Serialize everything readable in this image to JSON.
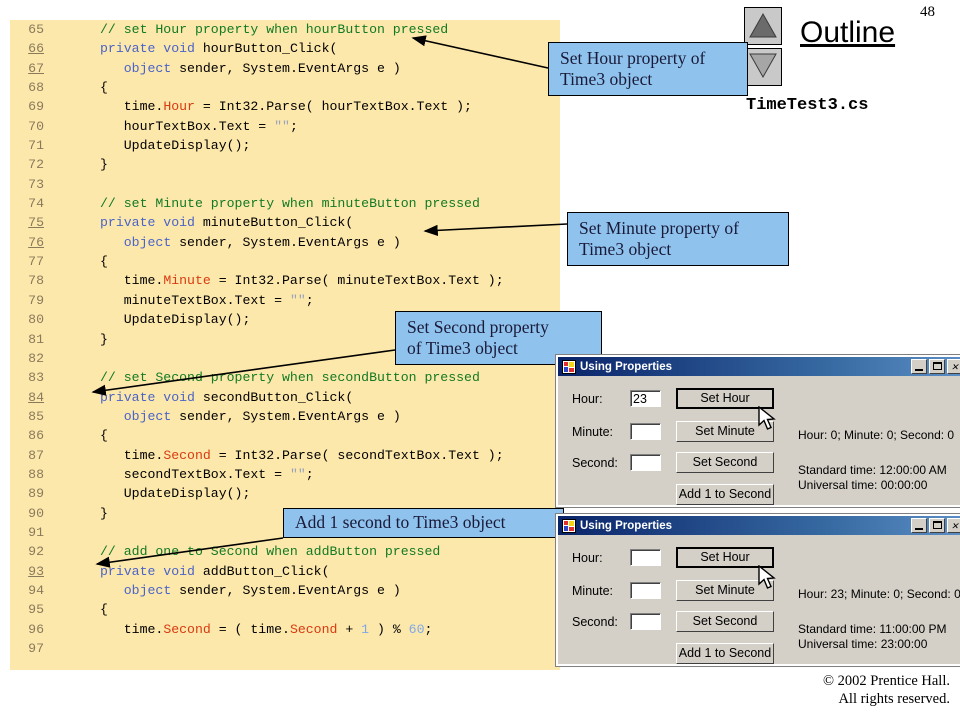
{
  "page": {
    "number": "48",
    "outline_title": "Outline",
    "file_label": "TimeTest3.cs"
  },
  "nav": {
    "up_icon": "triangle-up-icon",
    "down_icon": "triangle-down-icon"
  },
  "code": {
    "lines": [
      {
        "no": "65",
        "underline": false,
        "segments": [
          {
            "t": "// set Hour property when hourButton pressed",
            "c": "cm"
          }
        ]
      },
      {
        "no": "66",
        "underline": true,
        "segments": [
          {
            "t": "private void ",
            "c": "kw"
          },
          {
            "t": "hourButton_Click(",
            "c": ""
          }
        ]
      },
      {
        "no": "67",
        "underline": true,
        "segments": [
          {
            "t": "   ",
            "c": ""
          },
          {
            "t": "object",
            "c": "kw"
          },
          {
            "t": " sender, System.EventArgs e )",
            "c": ""
          }
        ]
      },
      {
        "no": "68",
        "underline": false,
        "segments": [
          {
            "t": "{",
            "c": ""
          }
        ]
      },
      {
        "no": "69",
        "underline": false,
        "segments": [
          {
            "t": "   time.",
            "c": ""
          },
          {
            "t": "Hour",
            "c": "pr"
          },
          {
            "t": " = Int32.Parse( hourTextBox.Text );",
            "c": ""
          }
        ]
      },
      {
        "no": "70",
        "underline": false,
        "segments": [
          {
            "t": "   hourTextBox.Text = ",
            "c": ""
          },
          {
            "t": "\"\"",
            "c": "st"
          },
          {
            "t": ";",
            "c": ""
          }
        ]
      },
      {
        "no": "71",
        "underline": false,
        "segments": [
          {
            "t": "   UpdateDisplay();",
            "c": ""
          }
        ]
      },
      {
        "no": "72",
        "underline": false,
        "segments": [
          {
            "t": "}",
            "c": ""
          }
        ]
      },
      {
        "no": "73",
        "underline": false,
        "segments": [
          {
            "t": "",
            "c": ""
          }
        ]
      },
      {
        "no": "74",
        "underline": false,
        "segments": [
          {
            "t": "// set Minute property when minuteButton pressed",
            "c": "cm"
          }
        ]
      },
      {
        "no": "75",
        "underline": true,
        "segments": [
          {
            "t": "private void ",
            "c": "kw"
          },
          {
            "t": "minuteButton_Click(",
            "c": ""
          }
        ]
      },
      {
        "no": "76",
        "underline": true,
        "segments": [
          {
            "t": "   ",
            "c": ""
          },
          {
            "t": "object",
            "c": "kw"
          },
          {
            "t": " sender, System.EventArgs e )",
            "c": ""
          }
        ]
      },
      {
        "no": "77",
        "underline": false,
        "segments": [
          {
            "t": "{",
            "c": ""
          }
        ]
      },
      {
        "no": "78",
        "underline": false,
        "segments": [
          {
            "t": "   time.",
            "c": ""
          },
          {
            "t": "Minute",
            "c": "pr"
          },
          {
            "t": " = Int32.Parse( minuteTextBox.Text );",
            "c": ""
          }
        ]
      },
      {
        "no": "79",
        "underline": false,
        "segments": [
          {
            "t": "   minuteTextBox.Text = ",
            "c": ""
          },
          {
            "t": "\"\"",
            "c": "st"
          },
          {
            "t": ";",
            "c": ""
          }
        ]
      },
      {
        "no": "80",
        "underline": false,
        "segments": [
          {
            "t": "   UpdateDisplay();",
            "c": ""
          }
        ]
      },
      {
        "no": "81",
        "underline": false,
        "segments": [
          {
            "t": "}",
            "c": ""
          }
        ]
      },
      {
        "no": "82",
        "underline": false,
        "segments": [
          {
            "t": "",
            "c": ""
          }
        ]
      },
      {
        "no": "83",
        "underline": false,
        "segments": [
          {
            "t": "// set Second property when secondButton pressed",
            "c": "cm"
          }
        ]
      },
      {
        "no": "84",
        "underline": true,
        "segments": [
          {
            "t": "private void ",
            "c": "kw"
          },
          {
            "t": "secondButton_Click(",
            "c": ""
          }
        ]
      },
      {
        "no": "85",
        "underline": false,
        "segments": [
          {
            "t": "   ",
            "c": ""
          },
          {
            "t": "object",
            "c": "kw"
          },
          {
            "t": " sender, System.EventArgs e )",
            "c": ""
          }
        ]
      },
      {
        "no": "86",
        "underline": false,
        "segments": [
          {
            "t": "{",
            "c": ""
          }
        ]
      },
      {
        "no": "87",
        "underline": false,
        "segments": [
          {
            "t": "   time.",
            "c": ""
          },
          {
            "t": "Second",
            "c": "pr"
          },
          {
            "t": " = Int32.Parse( secondTextBox.Text );",
            "c": ""
          }
        ]
      },
      {
        "no": "88",
        "underline": false,
        "segments": [
          {
            "t": "   secondTextBox.Text = ",
            "c": ""
          },
          {
            "t": "\"\"",
            "c": "st"
          },
          {
            "t": ";",
            "c": ""
          }
        ]
      },
      {
        "no": "89",
        "underline": false,
        "segments": [
          {
            "t": "   UpdateDisplay();",
            "c": ""
          }
        ]
      },
      {
        "no": "90",
        "underline": false,
        "segments": [
          {
            "t": "}",
            "c": ""
          }
        ]
      },
      {
        "no": "91",
        "underline": false,
        "segments": [
          {
            "t": "",
            "c": ""
          }
        ]
      },
      {
        "no": "92",
        "underline": false,
        "segments": [
          {
            "t": "// add one to Second when addButton pressed",
            "c": "cm"
          }
        ]
      },
      {
        "no": "93",
        "underline": true,
        "segments": [
          {
            "t": "private void ",
            "c": "kw"
          },
          {
            "t": "addButton_Click(",
            "c": ""
          }
        ]
      },
      {
        "no": "94",
        "underline": false,
        "segments": [
          {
            "t": "   ",
            "c": ""
          },
          {
            "t": "object",
            "c": "kw"
          },
          {
            "t": " sender, System.EventArgs e )",
            "c": ""
          }
        ]
      },
      {
        "no": "95",
        "underline": false,
        "segments": [
          {
            "t": "{",
            "c": ""
          }
        ]
      },
      {
        "no": "96",
        "underline": false,
        "segments": [
          {
            "t": "   time.",
            "c": ""
          },
          {
            "t": "Second",
            "c": "pr"
          },
          {
            "t": " = ( time.",
            "c": ""
          },
          {
            "t": "Second",
            "c": "pr"
          },
          {
            "t": " + ",
            "c": ""
          },
          {
            "t": "1",
            "c": "nm"
          },
          {
            "t": " ) % ",
            "c": ""
          },
          {
            "t": "60",
            "c": "nm"
          },
          {
            "t": ";",
            "c": ""
          }
        ]
      },
      {
        "no": "97",
        "underline": false,
        "segments": [
          {
            "t": "",
            "c": ""
          }
        ]
      }
    ]
  },
  "callouts": [
    {
      "id": "hour",
      "line1": "Set Hour property of",
      "line2": "Time3 object"
    },
    {
      "id": "minute",
      "line1": "Set Minute property of",
      "line2": "Time3 object"
    },
    {
      "id": "second",
      "line1": "Set Second property",
      "line2": "of Time3 object"
    },
    {
      "id": "add",
      "line1": "Add 1 second to Time3  object",
      "line2": ""
    }
  ],
  "dialogs": [
    {
      "title": "Using Properties",
      "hour_label": "Hour:",
      "minute_label": "Minute:",
      "second_label": "Second:",
      "hour_value": "23",
      "minute_value": "",
      "second_value": "",
      "set_hour": "Set Hour",
      "set_minute": "Set Minute",
      "set_second": "Set Second",
      "add_second": "Add 1 to Second",
      "status": "Hour: 0; Minute: 0; Second: 0",
      "standard_time": "Standard time: 12:00:00  AM",
      "universal_time": "Universal time: 00:00:00",
      "minimize": "minimize-icon",
      "maximize": "maximize-icon",
      "close": "close-icon"
    },
    {
      "title": "Using Properties",
      "hour_label": "Hour:",
      "minute_label": "Minute:",
      "second_label": "Second:",
      "hour_value": "",
      "minute_value": "",
      "second_value": "",
      "set_hour": "Set Hour",
      "set_minute": "Set Minute",
      "set_second": "Set Second",
      "add_second": "Add 1 to Second",
      "status": "Hour: 23; Minute: 0; Second: 0",
      "standard_time": "Standard time: 11:00:00  PM",
      "universal_time": "Universal time: 23:00:00",
      "minimize": "minimize-icon",
      "maximize": "maximize-icon",
      "close": "close-icon"
    }
  ],
  "footer": {
    "line1": "© 2002 Prentice Hall.",
    "line2": "All rights reserved."
  },
  "colors": {
    "code_bg": "#fde8ac",
    "callout_bg": "#8fc3ee",
    "comment": "#127a23",
    "keyword": "#4a63c8",
    "property": "#d93a10",
    "dialog_face": "#d4d0c8",
    "titlebar": "#0a246a"
  }
}
